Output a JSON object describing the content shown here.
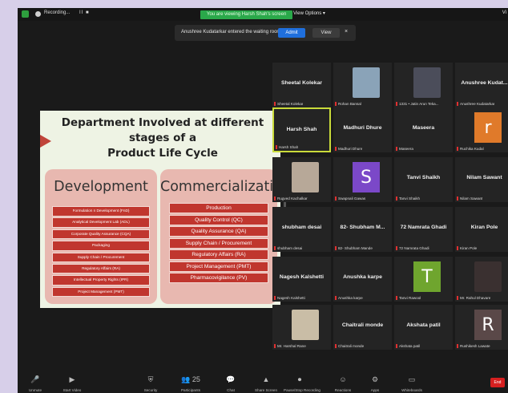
{
  "topbar": {
    "recording_label": "Recording...",
    "pause_controls": "II  ■",
    "viewing_banner": "You are viewing Harsh Shah's screen",
    "view_options": "View Options ▾",
    "view_label": "Vi"
  },
  "notification": {
    "message": "Anushree Kudatarkar entered the waiting room",
    "admit_label": "Admit",
    "view_label": "View",
    "close_glyph": "×"
  },
  "slide": {
    "title_line1": "Department Involved at different stages of a",
    "title_line2": "Product Life Cycle",
    "development": {
      "heading": "Development",
      "items": [
        "Formulation n Development (FnD)",
        "Analytical Development Lab (ADL)",
        "Corporate Quality Assurance (CQA)",
        "Packaging",
        "Supply Chain / Procurement",
        "Regulatory Affairs (RA)",
        "Intellectual Property Rights (IPR)",
        "Project Management (PMT)"
      ]
    },
    "commercialization": {
      "heading": "Commercialization",
      "items": [
        "Production",
        "Quality Control (QC)",
        "Quality Assurance (QA)",
        "Supply Chain / Procurement",
        "Regulatory Affairs (RA)",
        "Project Management (PMT)",
        "Pharmacovigilance (PV)"
      ]
    }
  },
  "participants": [
    {
      "name": "Sheetal Kolekar",
      "label": "Sheetal Kolekar",
      "avatar": ""
    },
    {
      "name": "",
      "label": "Rohan Bansal",
      "avatar": "photo",
      "color": "#8aa3b8"
    },
    {
      "name": "",
      "label": "1331 • Jatin Arun Teka...",
      "avatar": "photo",
      "color": "#4b4d5a"
    },
    {
      "name": "Anushree Kudat...",
      "label": "Anushree Kudatarkar",
      "avatar": ""
    },
    {
      "name": "Harsh Shah",
      "label": "Harsh Shah",
      "avatar": "",
      "active": true
    },
    {
      "name": "Madhuri Dhure",
      "label": "Madhuri Dhure",
      "avatar": ""
    },
    {
      "name": "Maseera",
      "label": "Maseera",
      "avatar": ""
    },
    {
      "name": "",
      "label": "Ruchika Kudal",
      "avatar": "r",
      "color": "#e07a2a"
    },
    {
      "name": "",
      "label": "Rugved Kachalkar",
      "avatar": "photo",
      "color": "#b7a898"
    },
    {
      "name": "",
      "label": "Swapnali Gawas",
      "avatar": "S",
      "color": "#7b48c8"
    },
    {
      "name": "Tanvi Shaikh",
      "label": "Tanvi Shaikh",
      "avatar": ""
    },
    {
      "name": "Nilam Sawant",
      "label": "Nilam Sawant",
      "avatar": ""
    },
    {
      "name": "shubham desai",
      "label": "shubham desai",
      "avatar": ""
    },
    {
      "name": "82- Shubham M...",
      "label": "82- Shubham Mande",
      "avatar": ""
    },
    {
      "name": "72 Namrata Ghadi",
      "label": "72 Namrata Ghadi",
      "avatar": ""
    },
    {
      "name": "Kiran Pole",
      "label": "Kiran Pole",
      "avatar": ""
    },
    {
      "name": "Nagesh Kalshetti",
      "label": "Nagesh Kalshetti",
      "avatar": ""
    },
    {
      "name": "Anushka karpe",
      "label": "Anushka karpe",
      "avatar": ""
    },
    {
      "name": "",
      "label": "Tanvi Rawool",
      "avatar": "T",
      "color": "#6fa52e"
    },
    {
      "name": "",
      "label": "Mr. Rahul Dhavare",
      "avatar": "photo",
      "color": "#3a3030"
    },
    {
      "name": "",
      "label": "Mr. Harshal Rane",
      "avatar": "photo",
      "color": "#c9bda6"
    },
    {
      "name": "Chaitrali monde",
      "label": "Chaitrali monde",
      "avatar": ""
    },
    {
      "name": "Akshata patil",
      "label": "Akshata patil",
      "avatar": ""
    },
    {
      "name": "",
      "label": "Rushikesh Lawate",
      "avatar": "R",
      "color": "#5a4848"
    }
  ],
  "toolbar": {
    "items": [
      {
        "icon": "🎤",
        "label": "Unmute"
      },
      {
        "icon": "▶",
        "label": "Start Video"
      },
      {
        "icon": "⛨",
        "label": "Security"
      },
      {
        "icon": "👥 25",
        "label": "Participants"
      },
      {
        "icon": "💬",
        "label": "Chat"
      },
      {
        "icon": "▲",
        "label": "Share Screen"
      },
      {
        "icon": "⏺",
        "label": "Pause/Stop Recording"
      },
      {
        "icon": "☺",
        "label": "Reactions"
      },
      {
        "icon": "⚙",
        "label": "Apps"
      },
      {
        "icon": "▭",
        "label": "Whiteboards"
      }
    ],
    "end_label": "End"
  },
  "colors": {
    "share_green": "#2aa84a",
    "admit_blue": "#1f6fdc",
    "active_border": "#c9db3a",
    "slide_item_red": "#c0362e",
    "end_red": "#d62020"
  }
}
